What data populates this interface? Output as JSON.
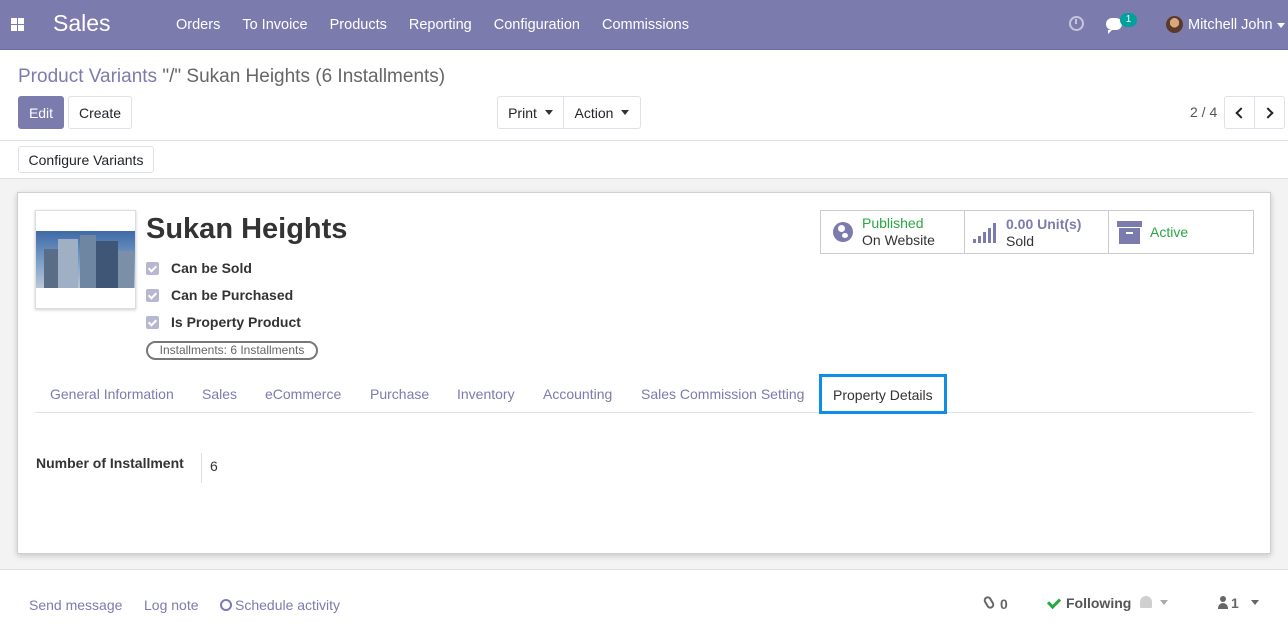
{
  "navbar": {
    "brand": "Sales",
    "menu": [
      "Orders",
      "To Invoice",
      "Products",
      "Reporting",
      "Configuration",
      "Commissions"
    ],
    "chat_badge": "1",
    "user": "Mitchell John",
    "color": "#7c7bad"
  },
  "control_panel": {
    "breadcrumb_parent": "Product Variants",
    "breadcrumb_sep": " \"/\" ",
    "breadcrumb_current": "Sukan Heights (6 Installments)",
    "edit_label": "Edit",
    "create_label": "Create",
    "print_label": "Print",
    "action_label": "Action",
    "pager": "2 / 4",
    "configure_label": "Configure Variants"
  },
  "product": {
    "name": "Sukan Heights",
    "checkboxes": [
      {
        "label": "Can be Sold",
        "checked": true
      },
      {
        "label": "Can be Purchased",
        "checked": true
      },
      {
        "label": "Is Property Product",
        "checked": true
      }
    ],
    "installments_badge": "Installments: 6 Installments"
  },
  "smart_buttons": {
    "published_line1": "Published",
    "published_line2": "On Website",
    "sold_value": "0.00 Unit(s)",
    "sold_label": "Sold",
    "active_label": "Active",
    "green": "#28a745"
  },
  "tabs": [
    "General Information",
    "Sales",
    "eCommerce",
    "Purchase",
    "Inventory",
    "Accounting",
    "Sales Commission Setting",
    "Property Details"
  ],
  "active_tab": "Property Details",
  "fields": {
    "installment_label": "Number of Installment",
    "installment_value": "6"
  },
  "chatter": {
    "send_message": "Send message",
    "log_note": "Log note",
    "schedule_activity": "Schedule activity",
    "attachments": "0",
    "following": "Following",
    "followers": "1"
  },
  "icons": [
    "apps-icon",
    "clock-icon",
    "chat-icon",
    "avatar",
    "globe-icon",
    "signal-icon",
    "archive-icon",
    "paperclip-icon",
    "check-icon",
    "bell-icon",
    "person-icon"
  ]
}
